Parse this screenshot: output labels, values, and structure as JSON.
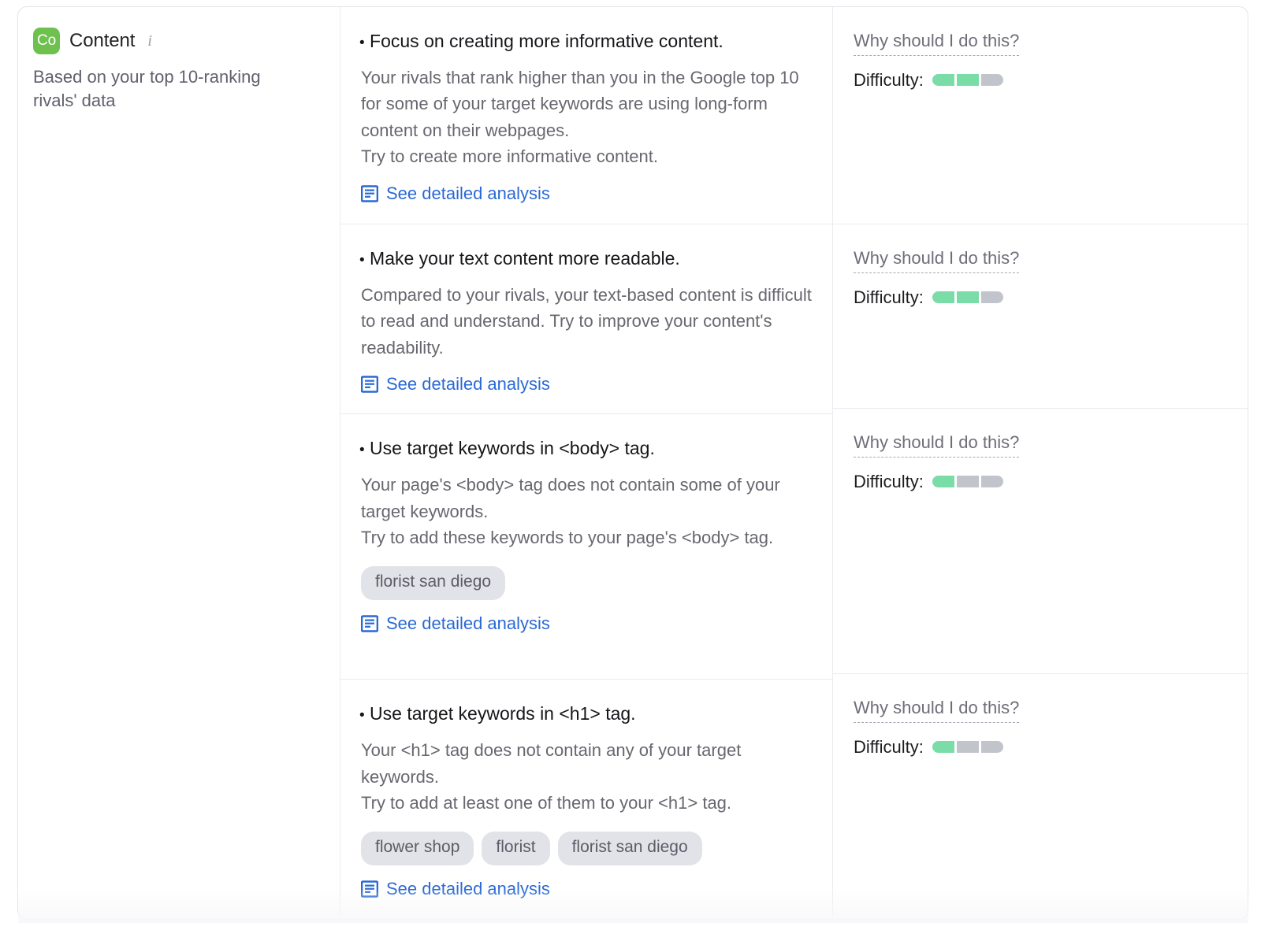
{
  "category": {
    "badge_text": "Co",
    "badge_color": "#6fc14f",
    "title": "Content",
    "info_icon": "info-icon",
    "subtitle": "Based on your top 10-ranking rivals' data"
  },
  "common": {
    "bullet": "•",
    "why_label": "Why should I do this?",
    "difficulty_label": "Difficulty:",
    "analysis_label": "See detailed analysis",
    "analysis_icon": "document-lines-icon",
    "difficulty_on_color": "#7adca6",
    "difficulty_off_color": "#c2c4cc",
    "link_color": "#2969d6",
    "chip_bg": "#e2e3e8"
  },
  "recommendations": [
    {
      "title": "Focus on creating more informative content.",
      "desc_lines": [
        "Your rivals that rank higher than you in the Google top 10 for some of your target keywords are using long-form content on their webpages.",
        "Try to create more informative content."
      ],
      "keywords": [],
      "analysis_label": "See detailed analysis",
      "why_label": "Why should I do this?",
      "difficulty_label": "Difficulty:",
      "difficulty_filled": 2,
      "difficulty_total": 3
    },
    {
      "title": "Make your text content more readable.",
      "desc_lines": [
        "Compared to your rivals, your text-based content is difficult to read and understand. Try to improve your content's readability."
      ],
      "keywords": [],
      "analysis_label": "See detailed analysis",
      "why_label": "Why should I do this?",
      "difficulty_label": "Difficulty:",
      "difficulty_filled": 2,
      "difficulty_total": 3
    },
    {
      "title": "Use target keywords in <body> tag.",
      "desc_lines": [
        "Your page's <body> tag does not contain some of your target keywords.",
        "Try to add these keywords to your page's <body> tag."
      ],
      "keywords": [
        "florist san diego"
      ],
      "analysis_label": "See detailed analysis",
      "why_label": "Why should I do this?",
      "difficulty_label": "Difficulty:",
      "difficulty_filled": 1,
      "difficulty_total": 3
    },
    {
      "title": "Use target keywords in <h1> tag.",
      "desc_lines": [
        "Your <h1> tag does not contain any of your target keywords.",
        "Try to add at least one of them to your <h1> tag."
      ],
      "keywords": [
        "flower shop",
        "florist",
        "florist san diego"
      ],
      "analysis_label": "See detailed analysis",
      "why_label": "Why should I do this?",
      "difficulty_label": "Difficulty:",
      "difficulty_filled": 1,
      "difficulty_total": 3
    }
  ]
}
